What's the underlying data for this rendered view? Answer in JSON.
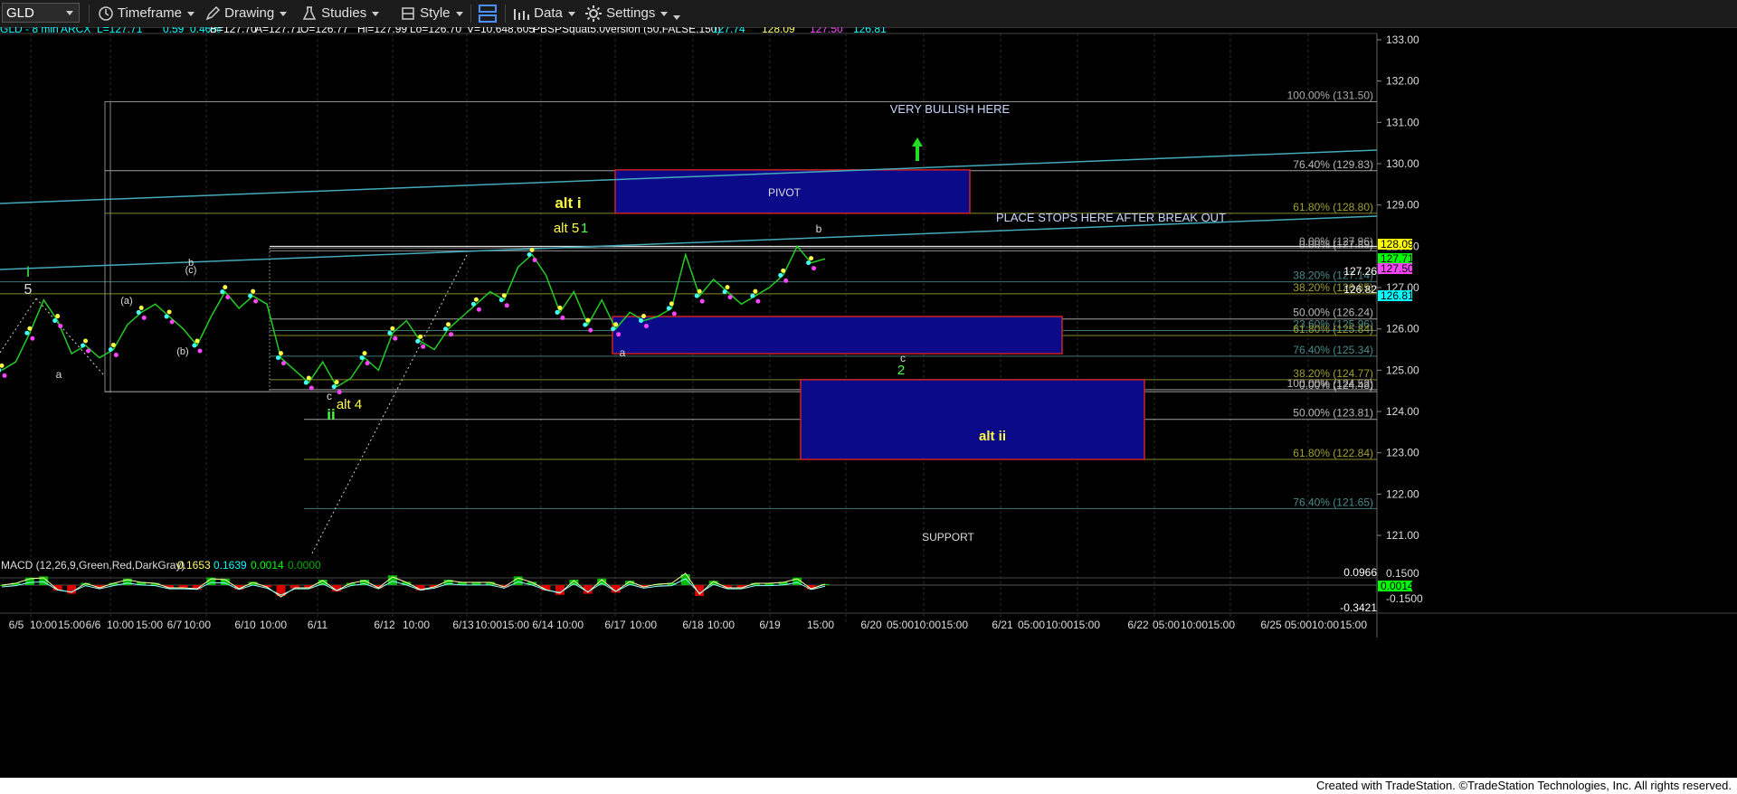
{
  "toolbar": {
    "symbol": "GLD",
    "timeframe": "Timeframe",
    "drawing": "Drawing",
    "studies": "Studies",
    "style": "Style",
    "data": "Data",
    "settings": "Settings"
  },
  "header": {
    "items": [
      {
        "text": "GLD - 8 min",
        "color": "#00ffff"
      },
      {
        "text": "ARCX",
        "color": "#00ffff"
      },
      {
        "text": "L=127.71",
        "color": "#00ffff"
      },
      {
        "text": "0.59",
        "color": "#00ffff"
      },
      {
        "text": "0.46%",
        "color": "#00ffff"
      },
      {
        "text": "B=127.70",
        "color": "#ffffff"
      },
      {
        "text": "A=127.71",
        "color": "#ffffff"
      },
      {
        "text": "O=126.77",
        "color": "#ffffff"
      },
      {
        "text": "Hi=127.99",
        "color": "#ffffff"
      },
      {
        "text": "Lo=126.70",
        "color": "#ffffff"
      },
      {
        "text": "V=10,648,605",
        "color": "#ffffff"
      },
      {
        "text": "PBSPSquat5.0version (50,FALSE,150)",
        "color": "#ffffff"
      },
      {
        "text": "127.74",
        "color": "#00ffff"
      },
      {
        "text": "128.09",
        "color": "#ffff66"
      },
      {
        "text": "127.50",
        "color": "#ff44ff"
      },
      {
        "text": "126.81",
        "color": "#00ffff"
      }
    ]
  },
  "chart_data": {
    "type": "line",
    "title": "GLD - 8 min",
    "ylim": [
      120.5,
      133.2
    ],
    "y_ticks": [
      "133.00",
      "132.00",
      "131.00",
      "130.00",
      "129.00",
      "128.00",
      "127.00",
      "126.00",
      "125.00",
      "124.00",
      "123.00",
      "122.00",
      "121.00"
    ],
    "x_ticks": [
      "6/5",
      "10:00",
      "15:00",
      "6/6",
      "10:00",
      "15:00",
      "6/7",
      "10:00",
      "6/10",
      "10:00",
      "6/11",
      "6/12",
      "10:00",
      "6/13",
      "10:00",
      "15:00",
      "6/14",
      "10:00",
      "6/17",
      "10:00",
      "6/18",
      "10:00",
      "6/19",
      "15:00",
      "6/20",
      "05:00",
      "10:00",
      "15:00",
      "6/21",
      "05:00",
      "10:00",
      "15:00",
      "6/22",
      "05:00",
      "10:00",
      "15:00",
      "6/25",
      "05:00",
      "10:00",
      "15:00"
    ],
    "series": [
      {
        "values": [
          125.0,
          125.2,
          125.9,
          126.7,
          126.2,
          125.4,
          125.6,
          125.3,
          125.5,
          126.1,
          126.4,
          126.6,
          126.3,
          126.0,
          125.6,
          126.3,
          126.9,
          126.5,
          126.8,
          126.6,
          125.3,
          125.0,
          124.7,
          125.2,
          124.6,
          124.8,
          125.3,
          125.0,
          125.9,
          126.2,
          125.7,
          125.5,
          126.0,
          126.3,
          126.6,
          126.9,
          126.7,
          127.5,
          127.8,
          127.3,
          126.4,
          126.9,
          126.1,
          126.7,
          126.0,
          126.4,
          126.2,
          126.3,
          126.5,
          127.8,
          126.8,
          127.2,
          126.9,
          126.6,
          126.8,
          127.0,
          127.3,
          128.0,
          127.6,
          127.7
        ]
      }
    ],
    "price_labels": [
      {
        "text": "128.09",
        "value": 128.09,
        "bg": "#ffff00",
        "fg": "#000000"
      },
      {
        "text": "127.71",
        "value": 127.71,
        "bg": "#00ff00",
        "fg": "#000000"
      },
      {
        "text": "127.50",
        "value": 127.5,
        "bg": "#ff44ff",
        "fg": "#000000"
      },
      {
        "text": "127.26",
        "value": 127.26,
        "bg": "#000000",
        "fg": "#ffffff"
      },
      {
        "text": "126.82",
        "value": 126.82,
        "bg": "#000000",
        "fg": "#ffffff"
      },
      {
        "text": "126.81",
        "value": 126.81,
        "bg": "#00ffff",
        "fg": "#000000"
      }
    ],
    "fib_labels": [
      {
        "text": "100.00% (131.50)",
        "value": 131.5,
        "color": "#aaaaaa"
      },
      {
        "text": "76.40% (129.83)",
        "value": 129.83,
        "color": "#bbbbbb"
      },
      {
        "text": "61.80% (128.80)",
        "value": 128.8,
        "color": "#a0a030"
      },
      {
        "text": "0.00% (127.96)",
        "value": 127.96,
        "color": "#aaaaaa"
      },
      {
        "text": "0.00% (127.89)",
        "value": 127.89,
        "color": "#aaaaaa"
      },
      {
        "text": "38.20% (127.14)",
        "value": 127.14,
        "color": "#4a8a8a"
      },
      {
        "text": "38.20% (126.85)",
        "value": 126.85,
        "color": "#a0a030"
      },
      {
        "text": "50.00% (126.24)",
        "value": 126.24,
        "color": "#bbbbbb"
      },
      {
        "text": "23.60% (125.96)",
        "value": 125.96,
        "color": "#4a8a8a"
      },
      {
        "text": "61.80% (125.84)",
        "value": 125.84,
        "color": "#a0a030"
      },
      {
        "text": "76.40% (125.34)",
        "value": 125.34,
        "color": "#4a8a8a"
      },
      {
        "text": "38.20% (124.77)",
        "value": 124.77,
        "color": "#a0a030"
      },
      {
        "text": "100.00% (124.53)",
        "value": 124.53,
        "color": "#bbbbbb"
      },
      {
        "text": "0.00% (124.48)",
        "value": 124.48,
        "color": "#bbbbbb"
      },
      {
        "text": "50.00% (123.81)",
        "value": 123.81,
        "color": "#bbbbbb"
      },
      {
        "text": "61.80% (122.84)",
        "value": 122.84,
        "color": "#a0a030"
      },
      {
        "text": "76.40% (121.65)",
        "value": 121.65,
        "color": "#4a8a8a"
      }
    ],
    "zones": [
      {
        "label": "PIVOT",
        "top": 129.85,
        "bottom": 128.8,
        "x_start": "6/17",
        "x_end": "6/20 15:00"
      },
      {
        "label": "",
        "top": 126.3,
        "bottom": 125.4,
        "x_start": "6/17",
        "x_end": "6/21 05:00"
      },
      {
        "label": "SUPPORT",
        "top": 124.77,
        "bottom": 122.84,
        "x_start": "6/19",
        "x_end": "6/21 15:00"
      }
    ],
    "annotations": [
      {
        "text": "VERY BULLISH HERE",
        "color": "#c8d8ff"
      },
      {
        "text": "PLACE STOPS HERE AFTER BREAK OUT",
        "color": "#c8d8ff"
      },
      {
        "text": "alt i",
        "color": "#ffff44"
      },
      {
        "text": "alt 5",
        "color": "#ffff44"
      },
      {
        "text": "1",
        "color": "#44ff44"
      },
      {
        "text": "alt 4",
        "color": "#ffff44"
      },
      {
        "text": "ii",
        "color": "#44ff44"
      },
      {
        "text": "alt ii",
        "color": "#ffff44"
      },
      {
        "text": "2",
        "color": "#44ff44"
      },
      {
        "text": "i",
        "color": "#44ff44"
      },
      {
        "text": "5",
        "color": "#dddddd"
      },
      {
        "text": "a",
        "color": "#dddddd"
      },
      {
        "text": "(a)",
        "color": "#dddddd"
      },
      {
        "text": "(b)",
        "color": "#dddddd"
      },
      {
        "text": "(c)",
        "color": "#dddddd"
      },
      {
        "text": "b",
        "color": "#dddddd"
      },
      {
        "text": "c",
        "color": "#dddddd"
      },
      {
        "text": "a",
        "color": "#dddddd"
      },
      {
        "text": "b",
        "color": "#dddddd"
      },
      {
        "text": "c",
        "color": "#dddddd"
      }
    ],
    "macd": {
      "label": "MACD (12,26,9,Green,Red,DarkGray)",
      "values": [
        {
          "text": "0.1653",
          "color": "#ffff66"
        },
        {
          "text": "0.1639",
          "color": "#00ffff"
        },
        {
          "text": "0.0014",
          "color": "#00ff00"
        },
        {
          "text": "0.0000",
          "color": "#00aa00"
        }
      ],
      "y_ticks": [
        "0.1500",
        "-0.1500"
      ],
      "side_labels": [
        {
          "text": "0.0966",
          "color": "#ffffff"
        },
        {
          "text": "0.0014",
          "color": "#00ff00"
        },
        {
          "text": "-0.3421",
          "color": "#ffffff"
        }
      ]
    }
  },
  "footer": "Created with TradeStation. ©TradeStation Technologies, Inc. All rights reserved."
}
